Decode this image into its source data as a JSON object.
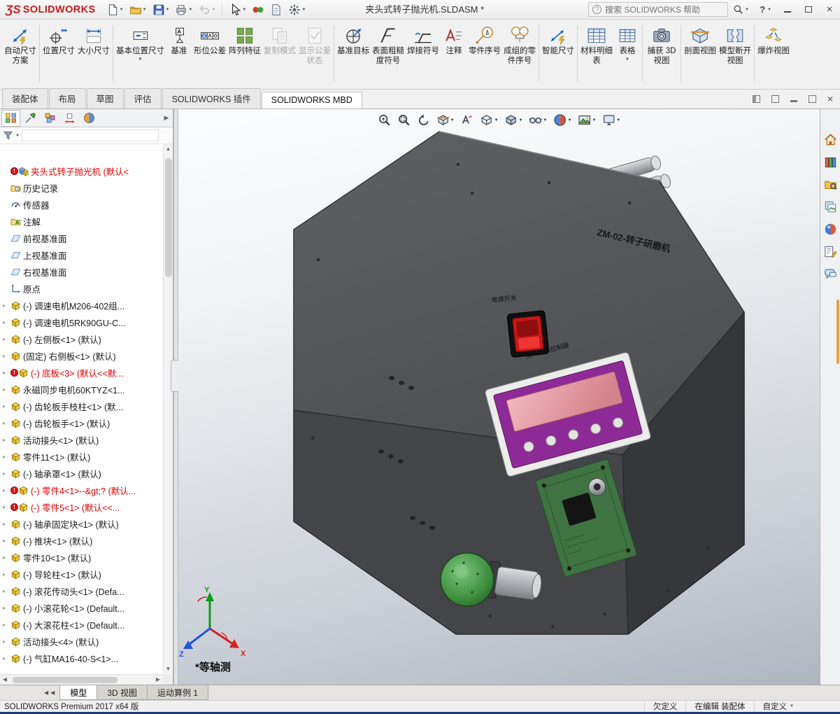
{
  "titlebar": {
    "logo_mark": "ƷS",
    "logo_text": "SOLIDWORKS",
    "title": "夹头式转子抛光机.SLDASM *",
    "search_placeholder": "搜索 SOLIDWORKS 帮助",
    "help_label": "?",
    "toolbar": [
      {
        "name": "new-doc",
        "dropdown": true,
        "disabled": false
      },
      {
        "name": "open",
        "dropdown": true,
        "disabled": false
      },
      {
        "name": "save",
        "dropdown": true,
        "disabled": false
      },
      {
        "name": "print",
        "dropdown": true,
        "disabled": false
      },
      {
        "name": "undo",
        "dropdown": true,
        "disabled": true
      },
      {
        "name": "select",
        "dropdown": true,
        "disabled": false
      },
      {
        "name": "rebuild",
        "dropdown": false,
        "disabled": false
      },
      {
        "name": "file-props",
        "dropdown": false,
        "disabled": false
      },
      {
        "name": "options",
        "dropdown": true,
        "disabled": false
      }
    ]
  },
  "ribbon": {
    "buttons": [
      {
        "label": "自动尺寸方案",
        "icon": "autodim",
        "enabled": true,
        "dropdown": false,
        "group_end": true
      },
      {
        "label": "位置尺寸",
        "icon": "locdim",
        "enabled": true,
        "dropdown": false,
        "group_end": false
      },
      {
        "label": "大小尺寸",
        "icon": "sizedim",
        "enabled": true,
        "dropdown": false,
        "group_end": true
      },
      {
        "label": "基本位置尺寸",
        "icon": "basicdim",
        "enabled": true,
        "dropdown": true,
        "group_end": false
      },
      {
        "label": "基准",
        "icon": "datum",
        "enabled": true,
        "dropdown": false,
        "group_end": false
      },
      {
        "label": "形位公差",
        "icon": "gtol",
        "enabled": true,
        "dropdown": false,
        "group_end": false
      },
      {
        "label": "阵列特征",
        "icon": "pattern",
        "enabled": true,
        "dropdown": false,
        "group_end": false
      },
      {
        "label": "复制模式",
        "icon": "copyscheme",
        "enabled": false,
        "dropdown": false,
        "group_end": false
      },
      {
        "label": "显示公差状态",
        "icon": "tolstatus",
        "enabled": false,
        "dropdown": false,
        "group_end": true
      },
      {
        "label": "基准目标",
        "icon": "datumtarget",
        "enabled": true,
        "dropdown": false,
        "group_end": false
      },
      {
        "label": "表面粗糙度符号",
        "icon": "surface",
        "enabled": true,
        "dropdown": false,
        "group_end": false
      },
      {
        "label": "焊接符号",
        "icon": "weld",
        "enabled": true,
        "dropdown": false,
        "group_end": false
      },
      {
        "label": "注释",
        "icon": "note",
        "enabled": true,
        "dropdown": false,
        "group_end": false
      },
      {
        "label": "零件序号",
        "icon": "balloon",
        "enabled": true,
        "dropdown": false,
        "group_end": false
      },
      {
        "label": "成组的零件序号",
        "icon": "groupballoon",
        "enabled": true,
        "dropdown": false,
        "group_end": true
      },
      {
        "label": "智能尺寸",
        "icon": "smartdim",
        "enabled": true,
        "dropdown": false,
        "group_end": true
      },
      {
        "label": "材料明细表",
        "icon": "bom",
        "enabled": true,
        "dropdown": false,
        "group_end": false
      },
      {
        "label": "表格",
        "icon": "table",
        "enabled": true,
        "dropdown": true,
        "group_end": true
      },
      {
        "label": "捕获 3D 视图",
        "icon": "capture3d",
        "enabled": true,
        "dropdown": false,
        "group_end": true
      },
      {
        "label": "剖面视图",
        "icon": "section",
        "enabled": true,
        "dropdown": false,
        "group_end": false
      },
      {
        "label": "模型断开视图",
        "icon": "breakview",
        "enabled": true,
        "dropdown": false,
        "group_end": true
      },
      {
        "label": "爆炸视图",
        "icon": "explode",
        "enabled": true,
        "dropdown": false,
        "group_end": false
      }
    ]
  },
  "command_tabs": {
    "tabs": [
      "装配体",
      "布局",
      "草图",
      "评估",
      "SOLIDWORKS 插件",
      "SOLIDWORKS MBD"
    ],
    "active": "SOLIDWORKS MBD"
  },
  "feature_panel": {
    "tabs": [
      "fm-tree",
      "fm-property",
      "fm-config",
      "fm-dimxpert",
      "fm-display"
    ]
  },
  "feature_tree": {
    "items": [
      {
        "label": "夹头式转子抛光机 (默认<",
        "icon": "assembly",
        "error": true,
        "red": true
      },
      {
        "label": "历史记录",
        "icon": "history",
        "error": false,
        "red": false
      },
      {
        "label": "传感器",
        "icon": "sensors",
        "error": false,
        "red": false
      },
      {
        "label": "注解",
        "icon": "annotations",
        "error": false,
        "red": false
      },
      {
        "label": "前视基准面",
        "icon": "plane",
        "error": false,
        "red": false
      },
      {
        "label": "上视基准面",
        "icon": "plane",
        "error": false,
        "red": false
      },
      {
        "label": "右视基准面",
        "icon": "plane",
        "error": false,
        "red": false
      },
      {
        "label": "原点",
        "icon": "origin",
        "error": false,
        "red": false
      },
      {
        "label": "(-) 调速电机M206-402组...",
        "icon": "part",
        "error": false,
        "red": false
      },
      {
        "label": "(-) 调速电机5RK90GU-C...",
        "icon": "part",
        "error": false,
        "red": false
      },
      {
        "label": "(-) 左侧板<1> (默认)",
        "icon": "part",
        "error": false,
        "red": false
      },
      {
        "label": "(固定) 右侧板<1> (默认)",
        "icon": "part",
        "error": false,
        "red": false
      },
      {
        "label": "(-) 底板<3> (默认<<默...",
        "icon": "part",
        "error": true,
        "red": true
      },
      {
        "label": "永磁同步电机60KTYZ<1...",
        "icon": "part",
        "error": false,
        "red": false
      },
      {
        "label": "(-) 齿轮板手枝柱<1> (默...",
        "icon": "part",
        "error": false,
        "red": false
      },
      {
        "label": "(-) 齿轮板手<1> (默认)",
        "icon": "part",
        "error": false,
        "red": false
      },
      {
        "label": "活动接头<1> (默认)",
        "icon": "part",
        "error": false,
        "red": false
      },
      {
        "label": "零件11<1> (默认)",
        "icon": "part",
        "error": false,
        "red": false
      },
      {
        "label": "(-) 轴承罩<1> (默认)",
        "icon": "part",
        "error": false,
        "red": false
      },
      {
        "label": "(-) 零件4<1>--&gt;? (默认...",
        "icon": "part",
        "error": true,
        "red": true
      },
      {
        "label": "(-) 零件5<1> (默认<<...",
        "icon": "part",
        "error": true,
        "red": true
      },
      {
        "label": "(-) 轴承固定块<1> (默认)",
        "icon": "part",
        "error": false,
        "red": false
      },
      {
        "label": "(-) 推块<1> (默认)",
        "icon": "part",
        "error": false,
        "red": false
      },
      {
        "label": "零件10<1> (默认)",
        "icon": "part",
        "error": false,
        "red": false
      },
      {
        "label": "(-) 导轮柱<1> (默认)",
        "icon": "part",
        "error": false,
        "red": false
      },
      {
        "label": "(-) 滚花传动头<1> (Defa...",
        "icon": "part",
        "error": false,
        "red": false
      },
      {
        "label": "(-) 小滚花轮<1> (Default...",
        "icon": "part",
        "error": false,
        "red": false
      },
      {
        "label": "(-) 大滚花柱<1> (Default...",
        "icon": "part",
        "error": false,
        "red": false
      },
      {
        "label": "活动接头<4> (默认)",
        "icon": "part",
        "error": false,
        "red": false
      },
      {
        "label": "(-) 气缸MA16-40-S<1>...",
        "icon": "part",
        "error": false,
        "red": false
      }
    ]
  },
  "viewport": {
    "view_orientation_label": "*等轴测",
    "machine_label": "ZM-02-转子研磨机",
    "power_switch_label": "电源开关",
    "controller_label": "频率显示控制器",
    "triad": {
      "x": "X",
      "y": "Y",
      "z": "Z"
    },
    "toolbar_icons": [
      {
        "name": "zoom-fit",
        "dropdown": false
      },
      {
        "name": "zoom-area",
        "dropdown": false
      },
      {
        "name": "previous-view",
        "dropdown": false
      },
      {
        "name": "section-view",
        "dropdown": true
      },
      {
        "name": "annotation-3d",
        "dropdown": false
      },
      {
        "name": "view-orientation",
        "dropdown": true
      },
      {
        "name": "display-style",
        "dropdown": true
      },
      {
        "name": "hide-show",
        "dropdown": true
      },
      {
        "name": "edit-appearance",
        "dropdown": true
      },
      {
        "name": "apply-scene",
        "dropdown": true
      },
      {
        "name": "view-settings",
        "dropdown": true
      }
    ]
  },
  "task_pane": {
    "icons": [
      "home",
      "design-library",
      "file-explorer",
      "view-palette",
      "appearances",
      "custom-properties",
      "forum"
    ]
  },
  "document_tabs": {
    "tabs": [
      "模型",
      "3D 视图",
      "运动算例 1"
    ],
    "active": "模型"
  },
  "status_bar": {
    "left": "SOLIDWORKS Premium 2017 x64 版",
    "items": [
      "欠定义",
      "在编辑 装配体",
      "自定义"
    ]
  }
}
